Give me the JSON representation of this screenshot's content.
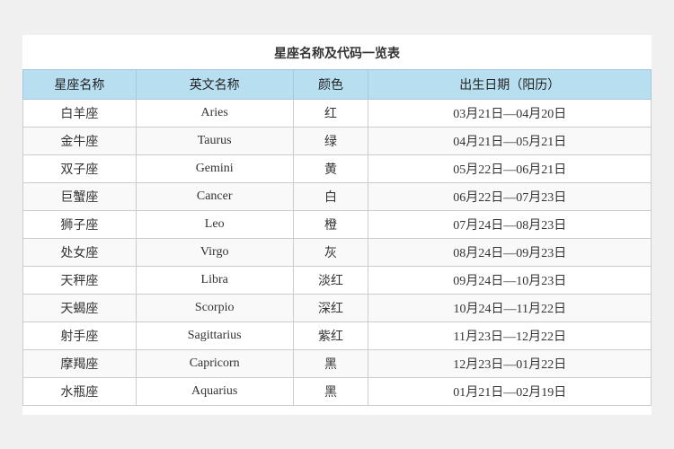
{
  "title": "星座名称及代码一览表",
  "headers": {
    "name": "星座名称",
    "english": "英文名称",
    "color": "颜色",
    "date": "出生日期（阳历）"
  },
  "rows": [
    {
      "name": "白羊座",
      "english": "Aries",
      "color": "红",
      "date": "03月21日—04月20日"
    },
    {
      "name": "金牛座",
      "english": "Taurus",
      "color": "绿",
      "date": "04月21日—05月21日"
    },
    {
      "name": "双子座",
      "english": "Gemini",
      "color": "黄",
      "date": "05月22日—06月21日"
    },
    {
      "name": "巨蟹座",
      "english": "Cancer",
      "color": "白",
      "date": "06月22日—07月23日"
    },
    {
      "name": "狮子座",
      "english": "Leo",
      "color": "橙",
      "date": "07月24日—08月23日"
    },
    {
      "name": "处女座",
      "english": "Virgo",
      "color": "灰",
      "date": "08月24日—09月23日"
    },
    {
      "name": "天秤座",
      "english": "Libra",
      "color": "淡红",
      "date": "09月24日—10月23日"
    },
    {
      "name": "天蝎座",
      "english": "Scorpio",
      "color": "深红",
      "date": "10月24日—11月22日"
    },
    {
      "name": "射手座",
      "english": "Sagittarius",
      "color": "紫红",
      "date": "11月23日—12月22日"
    },
    {
      "name": "摩羯座",
      "english": "Capricorn",
      "color": "黑",
      "date": "12月23日—01月22日"
    },
    {
      "name": "水瓶座",
      "english": "Aquarius",
      "color": "黑",
      "date": "01月21日—02月19日"
    }
  ]
}
